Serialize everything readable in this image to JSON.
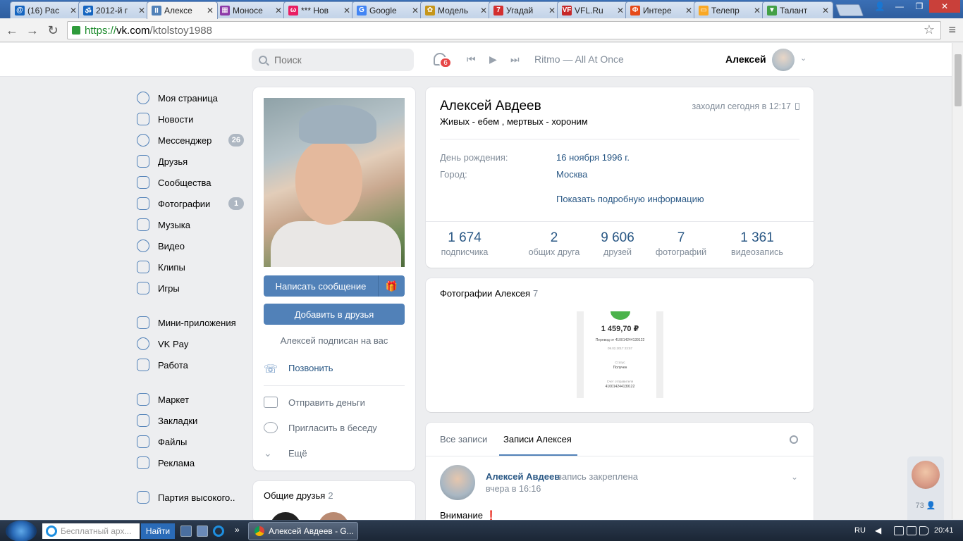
{
  "browser": {
    "tabs": [
      {
        "title": "(16) Рас",
        "icon": "mail-ru-icon",
        "color": "#1565c0",
        "glyph": "@"
      },
      {
        "title": "2012-й г",
        "icon": "om-icon",
        "color": "#1565c0",
        "glyph": "ॐ"
      },
      {
        "title": "Алексе",
        "icon": "vk-icon",
        "color": "#5181b8",
        "glyph": "II"
      },
      {
        "title": "Моносе",
        "icon": "news-icon",
        "color": "#8e3ba8",
        "glyph": "▦"
      },
      {
        "title": "*** Нов",
        "icon": "odnoklassniki-icon",
        "color": "#e91e63",
        "glyph": "ω"
      },
      {
        "title": "Google",
        "icon": "translate-icon",
        "color": "#4285f4",
        "glyph": "G"
      },
      {
        "title": "Модель",
        "icon": "world-icon",
        "color": "#c6961a",
        "glyph": "✿"
      },
      {
        "title": "Угадай",
        "icon": "seven-icon",
        "color": "#d32f2f",
        "glyph": "7"
      },
      {
        "title": "VFL.Ru",
        "icon": "vfl-icon",
        "color": "#c62828",
        "glyph": "VF"
      },
      {
        "title": "Интере",
        "icon": "pinterest-icon",
        "color": "#e64a19",
        "glyph": "Ф"
      },
      {
        "title": "Телепр",
        "icon": "tv-icon",
        "color": "#f9a825",
        "glyph": "▭"
      },
      {
        "title": "Талант",
        "icon": "download-icon",
        "color": "#43a047",
        "glyph": "▼"
      }
    ],
    "window_controls": {
      "minimize": "—",
      "maximize": "❐",
      "close": "✕"
    },
    "user_icon": "👤",
    "nav": {
      "back": "←",
      "forward": "→",
      "reload": "↻"
    },
    "url": {
      "scheme": "https://",
      "host": "vk.com",
      "path": "/ktolstoy1988"
    },
    "star": "☆",
    "menu": "≡"
  },
  "vk_header": {
    "search_placeholder": "Поиск",
    "notifications_count": "6",
    "player": {
      "prev": "⏮",
      "play": "▶",
      "next": "⏭"
    },
    "track": "Ritmo — All At Once",
    "user_name": "Алексей",
    "chevron": "⌄"
  },
  "left_menu": {
    "groups": [
      [
        {
          "label": "Моя страница",
          "icon": "user-circle-icon",
          "badge": ""
        },
        {
          "label": "Новости",
          "icon": "newspaper-icon",
          "badge": ""
        },
        {
          "label": "Мессенджер",
          "icon": "chat-bubble-icon",
          "badge": "26"
        },
        {
          "label": "Друзья",
          "icon": "friends-icon",
          "badge": ""
        },
        {
          "label": "Сообщества",
          "icon": "communities-icon",
          "badge": ""
        },
        {
          "label": "Фотографии",
          "icon": "photo-icon",
          "badge": "1"
        },
        {
          "label": "Музыка",
          "icon": "music-note-icon",
          "badge": ""
        },
        {
          "label": "Видео",
          "icon": "play-circle-icon",
          "badge": ""
        },
        {
          "label": "Клипы",
          "icon": "clips-icon",
          "badge": ""
        },
        {
          "label": "Игры",
          "icon": "gamepad-icon",
          "badge": ""
        }
      ],
      [
        {
          "label": "Мини-приложения",
          "icon": "grid-icon",
          "badge": ""
        },
        {
          "label": "VK Pay",
          "icon": "ruble-icon",
          "badge": ""
        },
        {
          "label": "Работа",
          "icon": "briefcase-icon",
          "badge": ""
        }
      ],
      [
        {
          "label": "Маркет",
          "icon": "shopping-bag-icon",
          "badge": ""
        },
        {
          "label": "Закладки",
          "icon": "star-icon",
          "badge": ""
        },
        {
          "label": "Файлы",
          "icon": "file-icon",
          "badge": ""
        },
        {
          "label": "Реклама",
          "icon": "megaphone-icon",
          "badge": ""
        }
      ],
      [
        {
          "label": "Партия высокого..",
          "icon": "group-icon",
          "badge": ""
        }
      ]
    ]
  },
  "profile_actions": {
    "write_message": "Написать сообщение",
    "gift_icon": "🎁",
    "add_friend": "Добавить в друзья",
    "subscribed": "Алексей подписан на вас",
    "call": "Позвонить",
    "send_money": "Отправить деньги",
    "invite_chat": "Пригласить в беседу",
    "more": "Ещё"
  },
  "common_friends": {
    "title": "Общие друзья",
    "count": "2"
  },
  "profile": {
    "name": "Алексей Авдеев",
    "status": "Живых - ебем , мертвых - хороним",
    "last_seen": "заходил сегодня в 12:17",
    "birthday_label": "День рождения:",
    "birthday_value": "16 ноября 1996 г.",
    "city_label": "Город:",
    "city_value": "Москва",
    "show_more": "Показать подробную информацию",
    "counters": [
      {
        "num": "1 674",
        "label": "подписчика"
      },
      {
        "num": "2",
        "label": "общих друга"
      },
      {
        "num": "9 606",
        "label": "друзей"
      },
      {
        "num": "7",
        "label": "фотографий"
      },
      {
        "num": "1 361",
        "label": "видеозапись"
      }
    ]
  },
  "photos": {
    "title": "Фотографии Алексея",
    "count": "7",
    "thumb": {
      "amount": "1 459,70 ₽",
      "line1": "Перевод от 410014244139122",
      "line2": "09.02.2017 23:57",
      "line3": "Статус",
      "line4": "Получен",
      "line5": "Счет отправителя",
      "line6": "410014244139122"
    }
  },
  "wall": {
    "tab_all": "Все записи",
    "tab_own": "Записи Алексея",
    "post": {
      "author": "Алексей Авдеев",
      "pinned": "запись закреплена",
      "time": "вчера в 16:16",
      "text": "Внимание",
      "text_mark": "❗"
    }
  },
  "side_widget": {
    "count": "73"
  },
  "taskbar": {
    "search_placeholder": "Бесплатный арх...",
    "find_button": "Найти",
    "more": "»",
    "chrome_task": "Алексей Авдеев - G...",
    "lang": "RU",
    "tray_arrow": "◀",
    "clock": "20:41"
  }
}
